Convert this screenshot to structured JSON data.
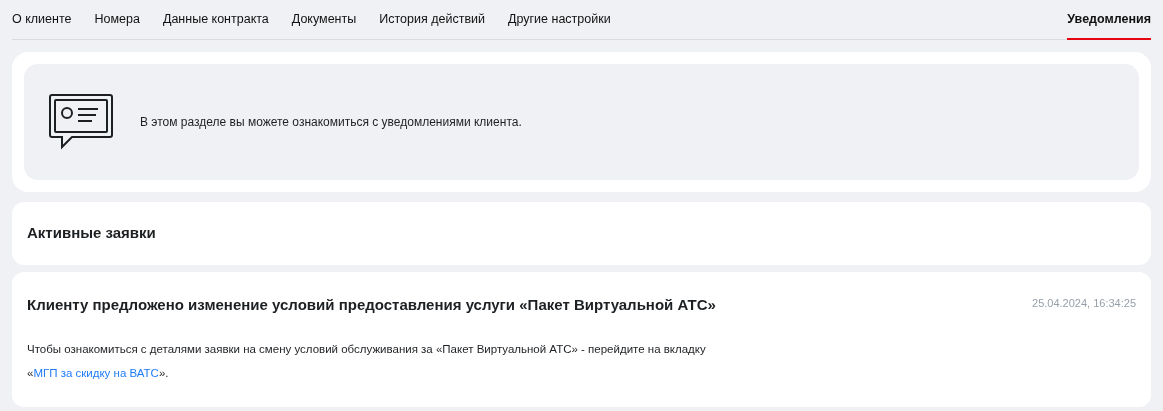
{
  "tabs": [
    {
      "label": "О клиенте",
      "selected": false
    },
    {
      "label": "Номера",
      "selected": false
    },
    {
      "label": "Данные контракта",
      "selected": false
    },
    {
      "label": "Документы",
      "selected": false
    },
    {
      "label": "История действий",
      "selected": false
    },
    {
      "label": "Другие настройки",
      "selected": false
    }
  ],
  "right_tabs": [
    {
      "label": "Уведомления",
      "selected": true
    }
  ],
  "info": {
    "text": "В этом разделе вы можете ознакомиться с уведомлениями клиента."
  },
  "section": {
    "title": "Активные заявки"
  },
  "requests": [
    {
      "title": "Клиенту предложено изменение условий предоставления услуги «Пакет Виртуальной АТС»",
      "date": "25.04.2024, 16:34:25",
      "text_before": "Чтобы ознакомиться с деталями заявки на смену условий обслуживания за «Пакет Виртуальной АТС» - перейдите на вкладку «",
      "link": "МГП за скидку на ВАТС",
      "text_after": "»."
    }
  ]
}
